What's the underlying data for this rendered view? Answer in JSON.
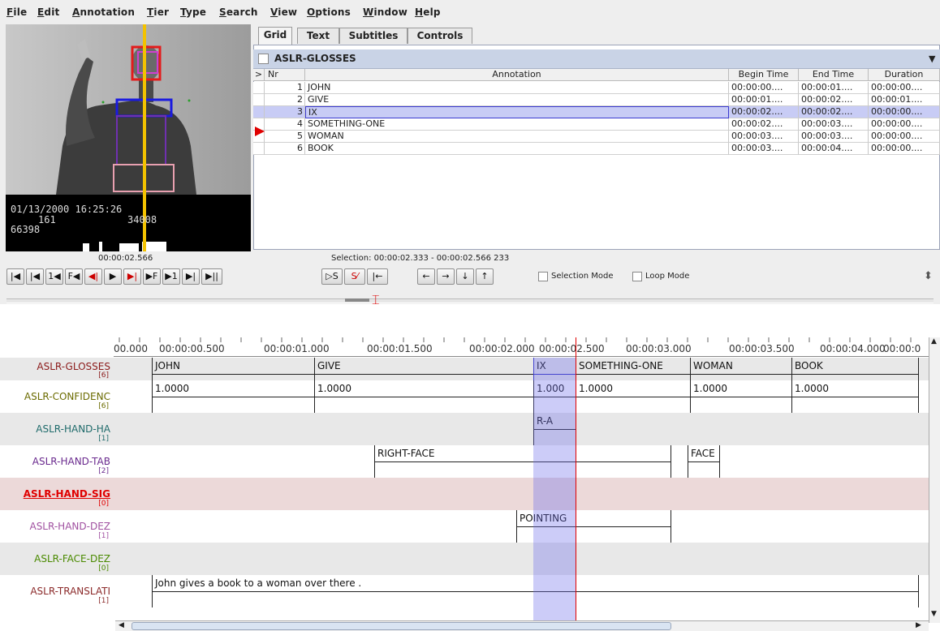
{
  "menu": [
    "File",
    "Edit",
    "Annotation",
    "Tier",
    "Type",
    "Search",
    "View",
    "Options",
    "Window",
    "Help"
  ],
  "video": {
    "datetime": "01/13/2000 16:25:26",
    "line2_a": "161",
    "line2_b": "34008",
    "line3": "66398"
  },
  "tabs": [
    "Grid",
    "Text",
    "Subtitles",
    "Controls"
  ],
  "grid": {
    "tier": "ASLR-GLOSSES",
    "headers": {
      "marker": ">",
      "nr": "Nr",
      "annotation": "Annotation",
      "begin": "Begin Time",
      "end": "End Time",
      "duration": "Duration"
    },
    "rows": [
      {
        "nr": "1",
        "annotation": "JOHN",
        "begin": "00:00:00....",
        "end": "00:00:01....",
        "duration": "00:00:00...."
      },
      {
        "nr": "2",
        "annotation": "GIVE",
        "begin": "00:00:01....",
        "end": "00:00:02....",
        "duration": "00:00:01...."
      },
      {
        "nr": "3",
        "annotation": "IX",
        "begin": "00:00:02....",
        "end": "00:00:02....",
        "duration": "00:00:00...."
      },
      {
        "nr": "4",
        "annotation": "SOMETHING-ONE",
        "begin": "00:00:02....",
        "end": "00:00:03....",
        "duration": "00:00:00...."
      },
      {
        "nr": "5",
        "annotation": "WOMAN",
        "begin": "00:00:03....",
        "end": "00:00:03....",
        "duration": "00:00:00...."
      },
      {
        "nr": "6",
        "annotation": "BOOK",
        "begin": "00:00:03....",
        "end": "00:00:04....",
        "duration": "00:00:00...."
      }
    ]
  },
  "media_time": "00:00:02.566",
  "selection": "Selection: 00:00:02.333 - 00:00:02.566  233",
  "controls": {
    "buttons": [
      "|◀",
      "|◀",
      "1◀",
      "F◀",
      "◀|",
      "▶",
      "▶|",
      "▶F",
      "▶1",
      "▶|",
      "▶||"
    ],
    "sel_buttons": [
      "▷S",
      "S⁄",
      "|←"
    ],
    "arrows": [
      "←",
      "→",
      "↓",
      "↑"
    ],
    "selection_mode": "Selection Mode",
    "loop_mode": "Loop Mode"
  },
  "ruler_labels": [
    "00.000",
    "00:00:00.500",
    "00:00:01.000",
    "00:00:01.500",
    "00:00:02.000",
    "00:00:02.500",
    "00:00:03.000",
    "00:00:03.500",
    "00:00:04.000",
    "00:00:0"
  ],
  "tiers": [
    {
      "name": "ASLR-GLOSSES",
      "count": "[6]",
      "color": "#8b1a1a",
      "bg": "#e8e8e8",
      "annotations": [
        {
          "text": "JOHN"
        },
        {
          "text": "GIVE"
        },
        {
          "text": "IX"
        },
        {
          "text": "SOMETHING-ONE"
        },
        {
          "text": "WOMAN"
        },
        {
          "text": "BOOK"
        }
      ]
    },
    {
      "name": "ASLR-CONFIDENC",
      "count": "[6]",
      "color": "#6b6b00",
      "bg": "#ffffff",
      "annotations": [
        {
          "text": "1.0000"
        },
        {
          "text": "1.0000"
        },
        {
          "text": "1.000"
        },
        {
          "text": "1.0000"
        },
        {
          "text": "1.0000"
        },
        {
          "text": "1.0000"
        }
      ]
    },
    {
      "name": "ASLR-HAND-HA",
      "count": "[1]",
      "color": "#1f6b6b",
      "bg": "#e8e8e8",
      "annotations": [
        {
          "text": "R-A"
        }
      ]
    },
    {
      "name": "ASLR-HAND-TAB",
      "count": "[2]",
      "color": "#6a2a8e",
      "bg": "#ffffff",
      "annotations": [
        {
          "text": "RIGHT-FACE"
        },
        {
          "text": "FACE"
        }
      ]
    },
    {
      "name": "ASLR-HAND-SIG",
      "count": "[0]",
      "color": "#e00000",
      "bg": "#ecd9d9",
      "active": true,
      "annotations": []
    },
    {
      "name": "ASLR-HAND-DEZ",
      "count": "[1]",
      "color": "#a050a0",
      "bg": "#ffffff",
      "annotations": [
        {
          "text": "POINTING"
        }
      ]
    },
    {
      "name": "ASLR-FACE-DEZ",
      "count": "[0]",
      "color": "#4a8a00",
      "bg": "#e8e8e8",
      "annotations": []
    },
    {
      "name": "ASLR-TRANSLATI",
      "count": "[1]",
      "color": "#8b2a2a",
      "bg": "#ffffff",
      "annotations": [
        {
          "text": "John gives a book to a woman over there ."
        }
      ]
    }
  ]
}
